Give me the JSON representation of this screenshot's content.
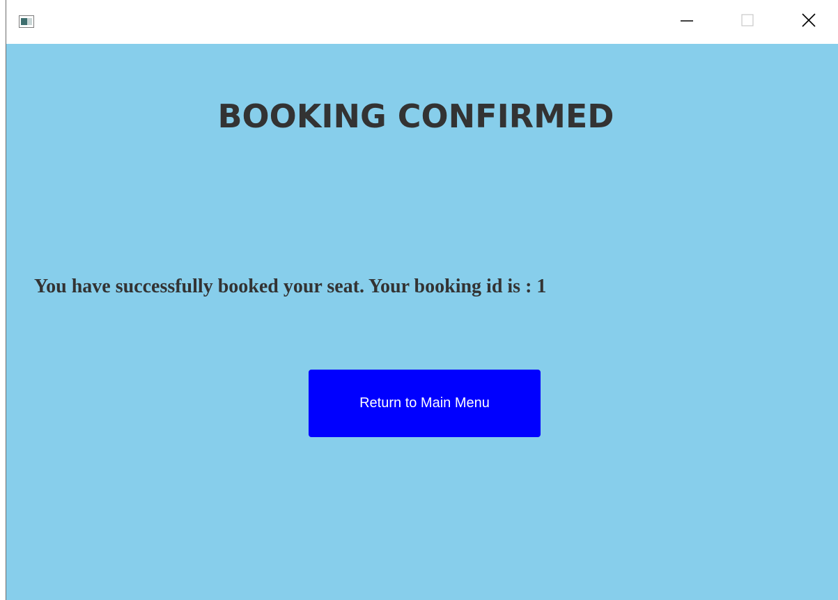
{
  "window": {
    "title": "",
    "controls": {
      "minimize_icon": "minimize-icon",
      "maximize_icon": "maximize-icon",
      "close_icon": "close-icon"
    }
  },
  "main": {
    "heading": "BOOKING CONFIRMED",
    "message": "You have successfully booked your seat. Your booking id is : 1",
    "return_button_label": "Return to Main Menu"
  },
  "colors": {
    "background": "#87ceeb",
    "button": "#0000ff",
    "text": "#333333"
  }
}
